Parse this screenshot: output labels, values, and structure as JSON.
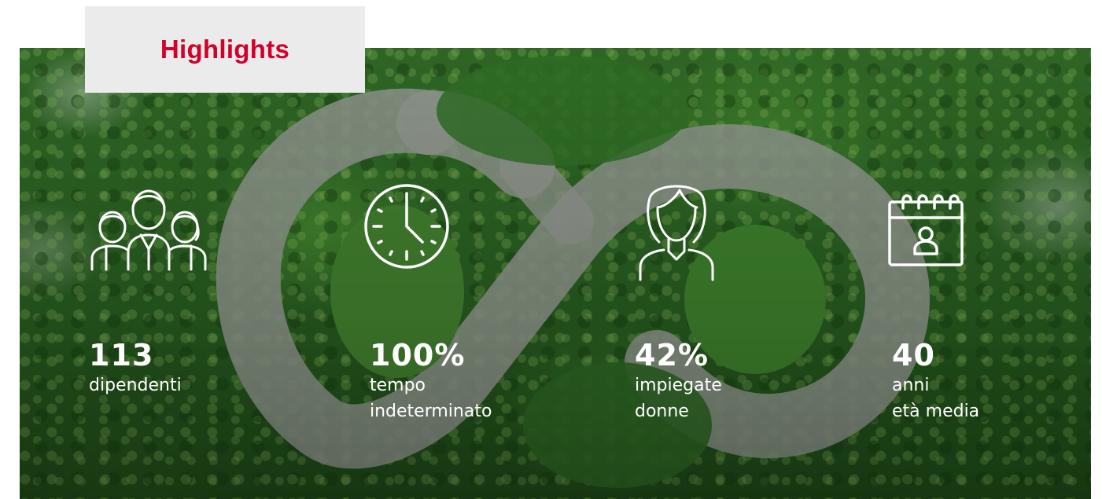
{
  "section": {
    "title": "Highlights",
    "accent_color": "#d2002a"
  },
  "background": {
    "description_icon": "infinity-lake-in-forest"
  },
  "stats": [
    {
      "icon": "people-group-icon",
      "value": "113",
      "label_line1": "dipendenti",
      "label_line2": ""
    },
    {
      "icon": "clock-icon",
      "value": "100%",
      "label_line1": "tempo",
      "label_line2": "indeterminato"
    },
    {
      "icon": "woman-icon",
      "value": "42%",
      "label_line1": "impiegate",
      "label_line2": "donne"
    },
    {
      "icon": "calendar-person-icon",
      "value": "40",
      "label_line1": "anni",
      "label_line2": "età media"
    }
  ]
}
